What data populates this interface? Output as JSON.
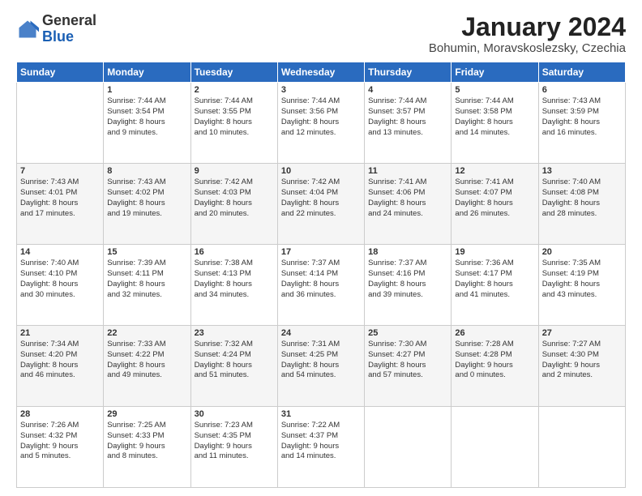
{
  "logo": {
    "general": "General",
    "blue": "Blue"
  },
  "title": "January 2024",
  "subtitle": "Bohumin, Moravskoslezsky, Czechia",
  "days_of_week": [
    "Sunday",
    "Monday",
    "Tuesday",
    "Wednesday",
    "Thursday",
    "Friday",
    "Saturday"
  ],
  "weeks": [
    [
      {
        "day": "",
        "sunrise": "",
        "sunset": "",
        "daylight": ""
      },
      {
        "day": "1",
        "sunrise": "Sunrise: 7:44 AM",
        "sunset": "Sunset: 3:54 PM",
        "daylight": "Daylight: 8 hours and 9 minutes."
      },
      {
        "day": "2",
        "sunrise": "Sunrise: 7:44 AM",
        "sunset": "Sunset: 3:55 PM",
        "daylight": "Daylight: 8 hours and 10 minutes."
      },
      {
        "day": "3",
        "sunrise": "Sunrise: 7:44 AM",
        "sunset": "Sunset: 3:56 PM",
        "daylight": "Daylight: 8 hours and 12 minutes."
      },
      {
        "day": "4",
        "sunrise": "Sunrise: 7:44 AM",
        "sunset": "Sunset: 3:57 PM",
        "daylight": "Daylight: 8 hours and 13 minutes."
      },
      {
        "day": "5",
        "sunrise": "Sunrise: 7:44 AM",
        "sunset": "Sunset: 3:58 PM",
        "daylight": "Daylight: 8 hours and 14 minutes."
      },
      {
        "day": "6",
        "sunrise": "Sunrise: 7:43 AM",
        "sunset": "Sunset: 3:59 PM",
        "daylight": "Daylight: 8 hours and 16 minutes."
      }
    ],
    [
      {
        "day": "7",
        "sunrise": "Sunrise: 7:43 AM",
        "sunset": "Sunset: 4:01 PM",
        "daylight": "Daylight: 8 hours and 17 minutes."
      },
      {
        "day": "8",
        "sunrise": "Sunrise: 7:43 AM",
        "sunset": "Sunset: 4:02 PM",
        "daylight": "Daylight: 8 hours and 19 minutes."
      },
      {
        "day": "9",
        "sunrise": "Sunrise: 7:42 AM",
        "sunset": "Sunset: 4:03 PM",
        "daylight": "Daylight: 8 hours and 20 minutes."
      },
      {
        "day": "10",
        "sunrise": "Sunrise: 7:42 AM",
        "sunset": "Sunset: 4:04 PM",
        "daylight": "Daylight: 8 hours and 22 minutes."
      },
      {
        "day": "11",
        "sunrise": "Sunrise: 7:41 AM",
        "sunset": "Sunset: 4:06 PM",
        "daylight": "Daylight: 8 hours and 24 minutes."
      },
      {
        "day": "12",
        "sunrise": "Sunrise: 7:41 AM",
        "sunset": "Sunset: 4:07 PM",
        "daylight": "Daylight: 8 hours and 26 minutes."
      },
      {
        "day": "13",
        "sunrise": "Sunrise: 7:40 AM",
        "sunset": "Sunset: 4:08 PM",
        "daylight": "Daylight: 8 hours and 28 minutes."
      }
    ],
    [
      {
        "day": "14",
        "sunrise": "Sunrise: 7:40 AM",
        "sunset": "Sunset: 4:10 PM",
        "daylight": "Daylight: 8 hours and 30 minutes."
      },
      {
        "day": "15",
        "sunrise": "Sunrise: 7:39 AM",
        "sunset": "Sunset: 4:11 PM",
        "daylight": "Daylight: 8 hours and 32 minutes."
      },
      {
        "day": "16",
        "sunrise": "Sunrise: 7:38 AM",
        "sunset": "Sunset: 4:13 PM",
        "daylight": "Daylight: 8 hours and 34 minutes."
      },
      {
        "day": "17",
        "sunrise": "Sunrise: 7:37 AM",
        "sunset": "Sunset: 4:14 PM",
        "daylight": "Daylight: 8 hours and 36 minutes."
      },
      {
        "day": "18",
        "sunrise": "Sunrise: 7:37 AM",
        "sunset": "Sunset: 4:16 PM",
        "daylight": "Daylight: 8 hours and 39 minutes."
      },
      {
        "day": "19",
        "sunrise": "Sunrise: 7:36 AM",
        "sunset": "Sunset: 4:17 PM",
        "daylight": "Daylight: 8 hours and 41 minutes."
      },
      {
        "day": "20",
        "sunrise": "Sunrise: 7:35 AM",
        "sunset": "Sunset: 4:19 PM",
        "daylight": "Daylight: 8 hours and 43 minutes."
      }
    ],
    [
      {
        "day": "21",
        "sunrise": "Sunrise: 7:34 AM",
        "sunset": "Sunset: 4:20 PM",
        "daylight": "Daylight: 8 hours and 46 minutes."
      },
      {
        "day": "22",
        "sunrise": "Sunrise: 7:33 AM",
        "sunset": "Sunset: 4:22 PM",
        "daylight": "Daylight: 8 hours and 49 minutes."
      },
      {
        "day": "23",
        "sunrise": "Sunrise: 7:32 AM",
        "sunset": "Sunset: 4:24 PM",
        "daylight": "Daylight: 8 hours and 51 minutes."
      },
      {
        "day": "24",
        "sunrise": "Sunrise: 7:31 AM",
        "sunset": "Sunset: 4:25 PM",
        "daylight": "Daylight: 8 hours and 54 minutes."
      },
      {
        "day": "25",
        "sunrise": "Sunrise: 7:30 AM",
        "sunset": "Sunset: 4:27 PM",
        "daylight": "Daylight: 8 hours and 57 minutes."
      },
      {
        "day": "26",
        "sunrise": "Sunrise: 7:28 AM",
        "sunset": "Sunset: 4:28 PM",
        "daylight": "Daylight: 9 hours and 0 minutes."
      },
      {
        "day": "27",
        "sunrise": "Sunrise: 7:27 AM",
        "sunset": "Sunset: 4:30 PM",
        "daylight": "Daylight: 9 hours and 2 minutes."
      }
    ],
    [
      {
        "day": "28",
        "sunrise": "Sunrise: 7:26 AM",
        "sunset": "Sunset: 4:32 PM",
        "daylight": "Daylight: 9 hours and 5 minutes."
      },
      {
        "day": "29",
        "sunrise": "Sunrise: 7:25 AM",
        "sunset": "Sunset: 4:33 PM",
        "daylight": "Daylight: 9 hours and 8 minutes."
      },
      {
        "day": "30",
        "sunrise": "Sunrise: 7:23 AM",
        "sunset": "Sunset: 4:35 PM",
        "daylight": "Daylight: 9 hours and 11 minutes."
      },
      {
        "day": "31",
        "sunrise": "Sunrise: 7:22 AM",
        "sunset": "Sunset: 4:37 PM",
        "daylight": "Daylight: 9 hours and 14 minutes."
      },
      {
        "day": "",
        "sunrise": "",
        "sunset": "",
        "daylight": ""
      },
      {
        "day": "",
        "sunrise": "",
        "sunset": "",
        "daylight": ""
      },
      {
        "day": "",
        "sunrise": "",
        "sunset": "",
        "daylight": ""
      }
    ]
  ]
}
